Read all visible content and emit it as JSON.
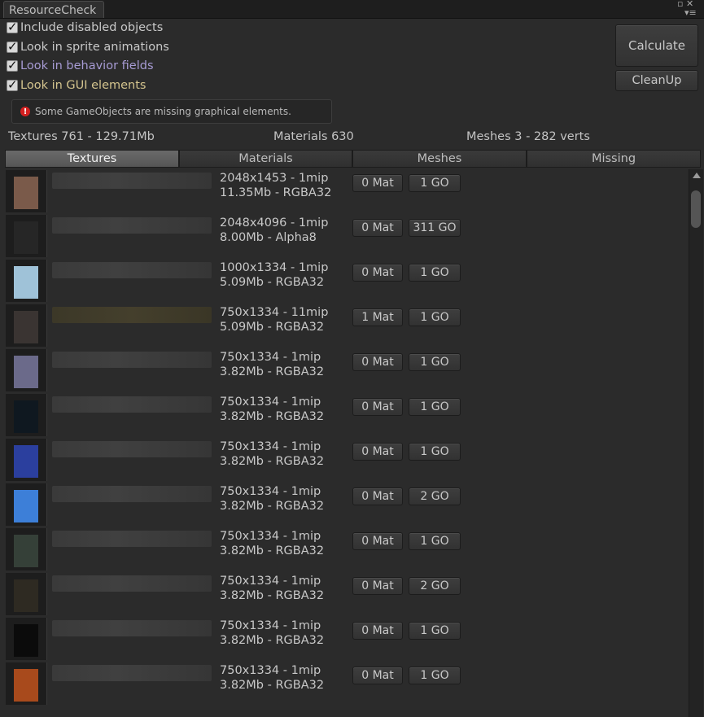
{
  "window": {
    "tab_title": "ResourceCheck",
    "maximize_glyph": "▫ ✕",
    "menu_glyph": "▾≡"
  },
  "options": [
    {
      "label": "Include disabled objects",
      "checked": true,
      "color": "#c8c8c8"
    },
    {
      "label": "Look in sprite animations",
      "checked": true,
      "color": "#c8c8c8"
    },
    {
      "label": "Look in behavior fields",
      "checked": true,
      "color": "#a79bd4"
    },
    {
      "label": "Look in GUI elements",
      "checked": true,
      "color": "#d4c48e"
    }
  ],
  "warning": {
    "icon": "error-icon",
    "text": "Some GameObjects are missing graphical elements."
  },
  "buttons": {
    "calculate": "Calculate",
    "cleanup": "CleanUp"
  },
  "summary": {
    "textures": "Textures 761 - 129.71Mb",
    "materials": "Materials 630",
    "meshes": "Meshes 3 - 282 verts"
  },
  "tabs": [
    {
      "label": "Textures",
      "active": true
    },
    {
      "label": "Materials",
      "active": false
    },
    {
      "label": "Meshes",
      "active": false
    },
    {
      "label": "Missing",
      "active": false
    }
  ],
  "rows": [
    {
      "dims": "2048x1453 - 1mip",
      "size": "11.35Mb - RGBA32",
      "mat": "0 Mat",
      "go": "1 GO",
      "thumb": "#7a5a4a",
      "highlight": false
    },
    {
      "dims": "2048x4096 - 1mip",
      "size": "8.00Mb - Alpha8",
      "mat": "0 Mat",
      "go": "311 GO",
      "thumb": "#262626",
      "highlight": false
    },
    {
      "dims": "1000x1334 - 1mip",
      "size": "5.09Mb - RGBA32",
      "mat": "0 Mat",
      "go": "1 GO",
      "thumb": "#9fc2d8",
      "highlight": false
    },
    {
      "dims": "750x1334 - 11mip",
      "size": "5.09Mb - RGBA32",
      "mat": "1 Mat",
      "go": "1 GO",
      "thumb": "#3a3432",
      "highlight": true
    },
    {
      "dims": "750x1334 - 1mip",
      "size": "3.82Mb - RGBA32",
      "mat": "0 Mat",
      "go": "1 GO",
      "thumb": "#6b6a8a",
      "highlight": false
    },
    {
      "dims": "750x1334 - 1mip",
      "size": "3.82Mb - RGBA32",
      "mat": "0 Mat",
      "go": "1 GO",
      "thumb": "#0f1820",
      "highlight": false
    },
    {
      "dims": "750x1334 - 1mip",
      "size": "3.82Mb - RGBA32",
      "mat": "0 Mat",
      "go": "1 GO",
      "thumb": "#2b3f9e",
      "highlight": false
    },
    {
      "dims": "750x1334 - 1mip",
      "size": "3.82Mb - RGBA32",
      "mat": "0 Mat",
      "go": "2 GO",
      "thumb": "#3d7fd8",
      "highlight": false
    },
    {
      "dims": "750x1334 - 1mip",
      "size": "3.82Mb - RGBA32",
      "mat": "0 Mat",
      "go": "1 GO",
      "thumb": "#354038",
      "highlight": false
    },
    {
      "dims": "750x1334 - 1mip",
      "size": "3.82Mb - RGBA32",
      "mat": "0 Mat",
      "go": "2 GO",
      "thumb": "#2e2a22",
      "highlight": false
    },
    {
      "dims": "750x1334 - 1mip",
      "size": "3.82Mb - RGBA32",
      "mat": "0 Mat",
      "go": "1 GO",
      "thumb": "#0b0b0b",
      "highlight": false
    },
    {
      "dims": "750x1334 - 1mip",
      "size": "3.82Mb - RGBA32",
      "mat": "0 Mat",
      "go": "1 GO",
      "thumb": "#a84a1c",
      "highlight": false
    }
  ]
}
